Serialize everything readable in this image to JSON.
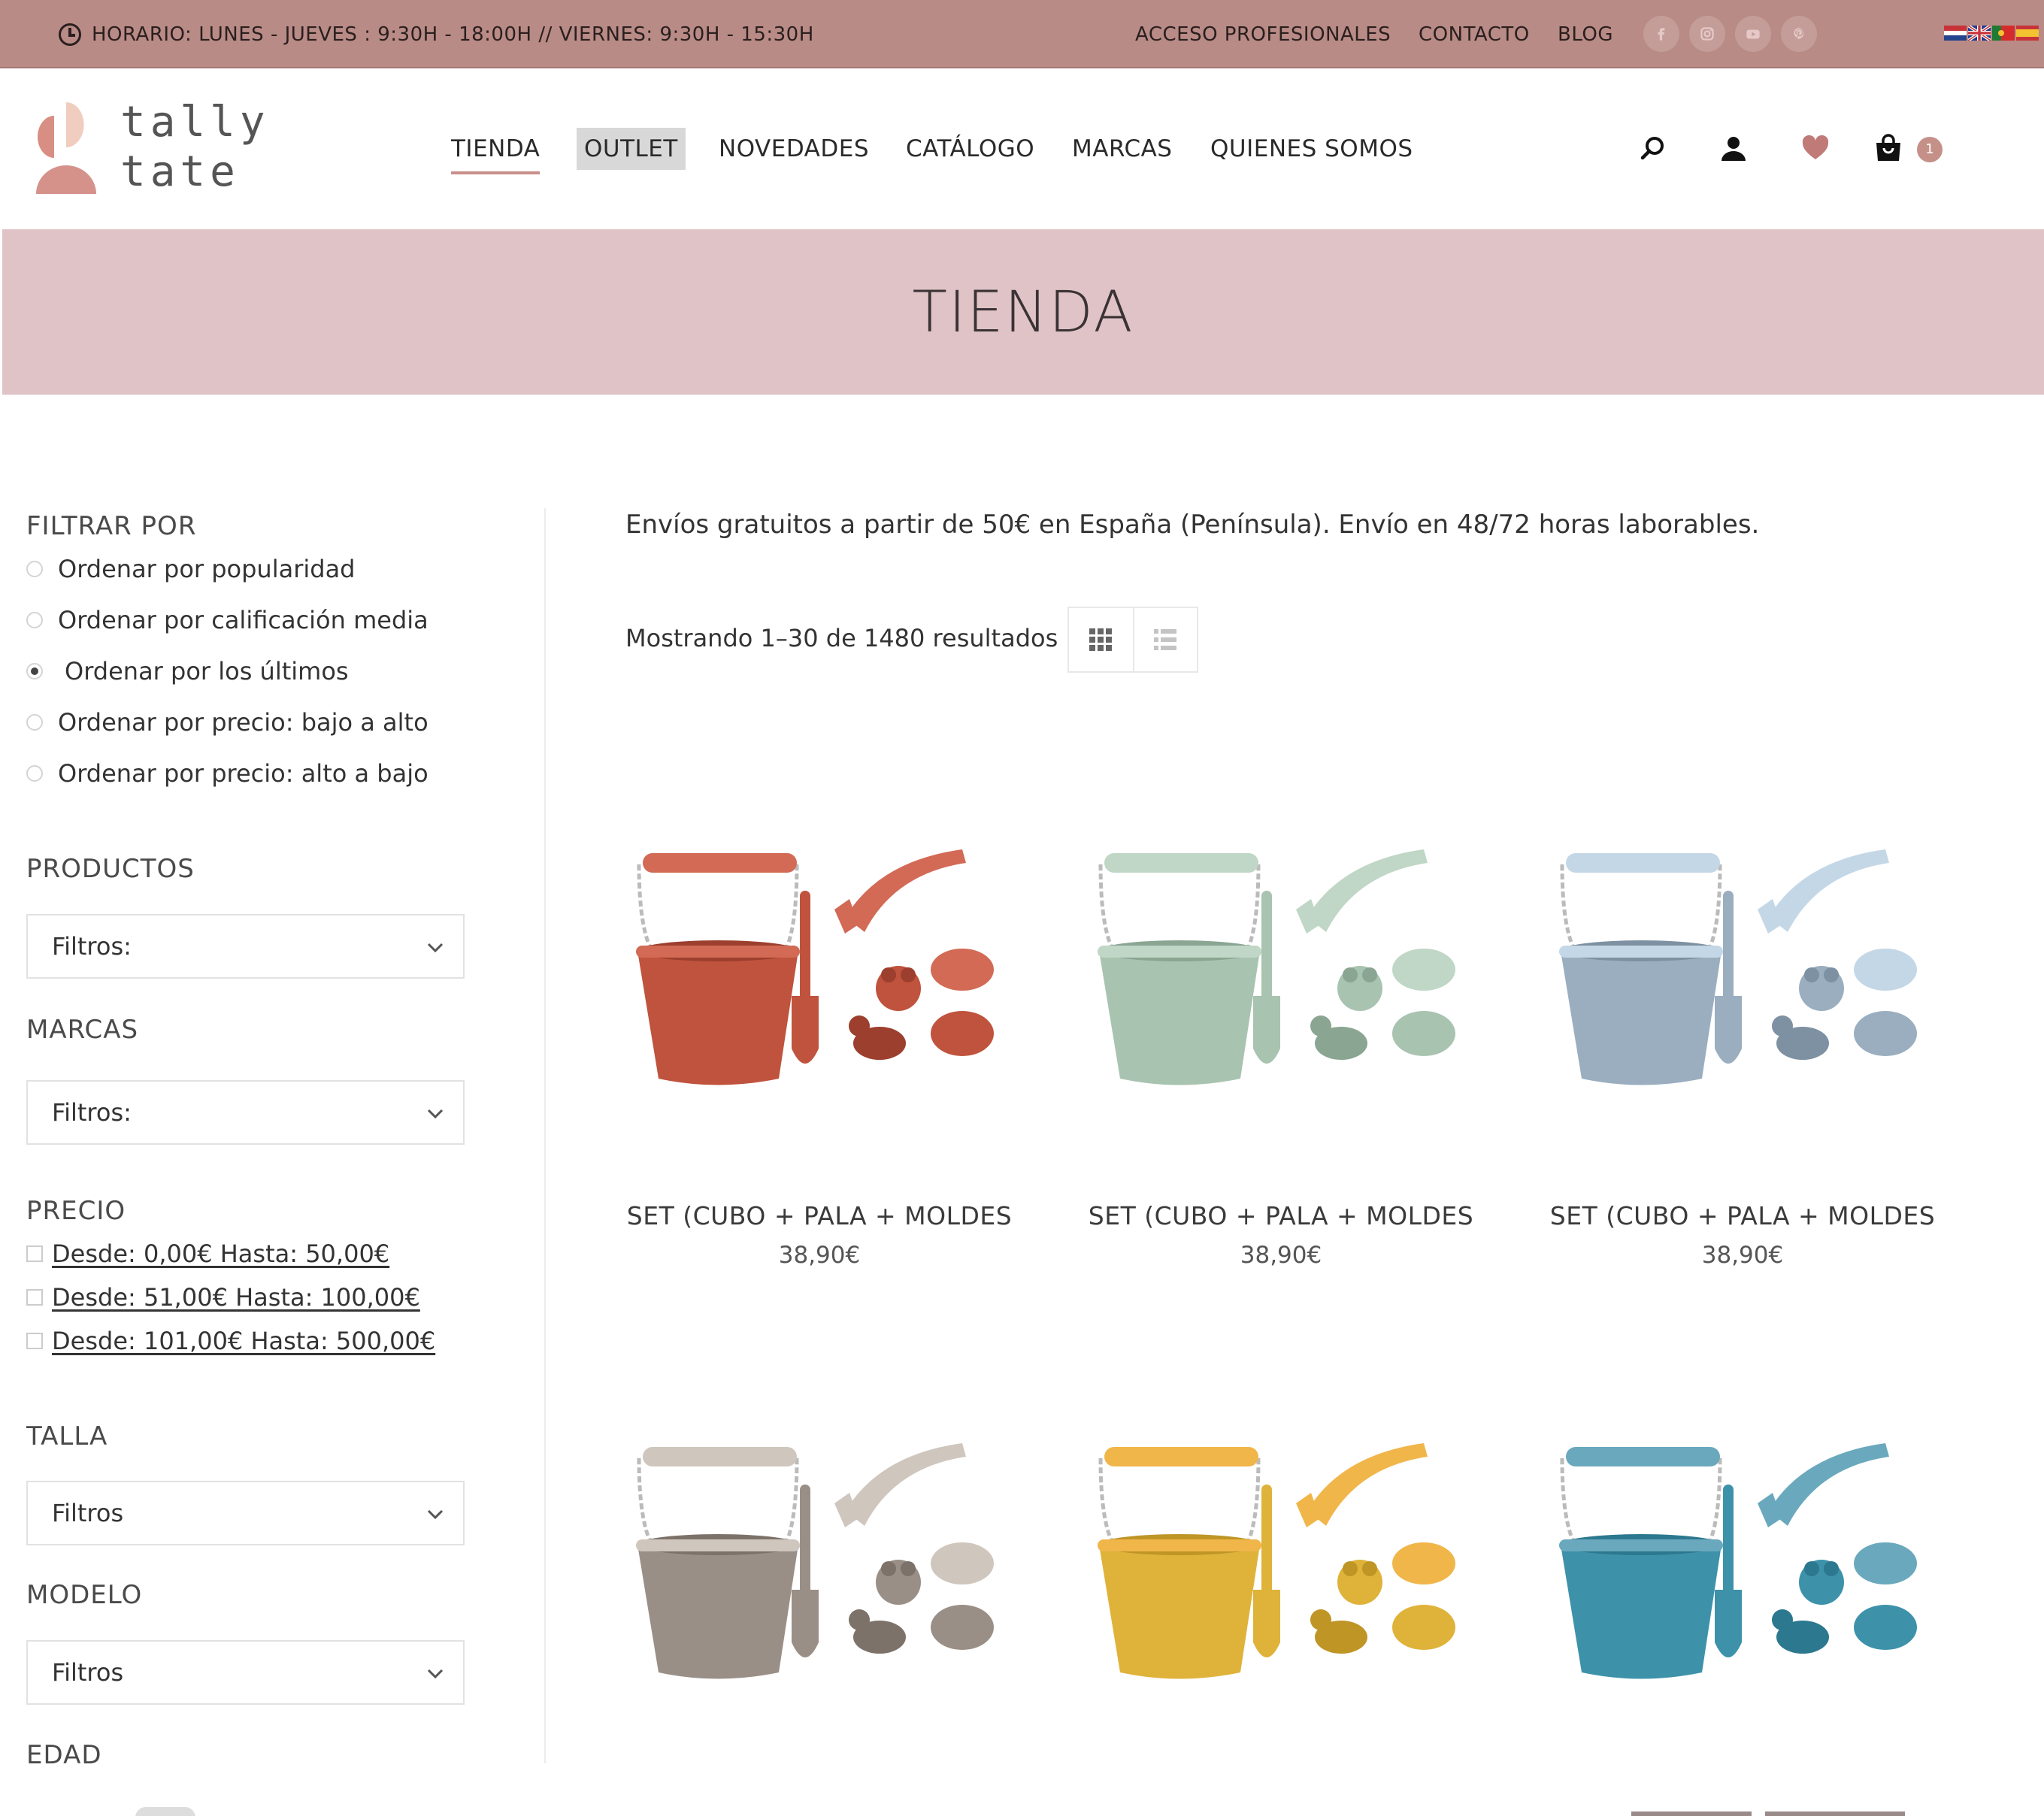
{
  "topbar": {
    "hours": "HORARIO: LUNES - JUEVES : 9:30H - 18:00H // VIERNES: 9:30H - 15:30H",
    "links": [
      "ACCESO PROFESIONALES",
      "CONTACTO",
      "BLOG"
    ],
    "social": [
      "facebook-icon",
      "instagram-icon",
      "youtube-icon",
      "pinterest-icon"
    ],
    "languages": [
      "nl",
      "en",
      "pt",
      "es"
    ],
    "bar_color": "#b98b86"
  },
  "header": {
    "logo_line1": "tally",
    "logo_line2": "tate",
    "nav": [
      "TIENDA",
      "OUTLET",
      "NOVEDADES",
      "CATÁLOGO",
      "MARCAS",
      "QUIENES SOMOS"
    ],
    "active_nav": "TIENDA",
    "cart_count": "1",
    "accent": "#c98f8a"
  },
  "hero": {
    "title": "TIENDA",
    "bg": "#e0c3c6"
  },
  "sidebar": {
    "filter_title": "FILTRAR POR",
    "sort_options": [
      "Ordenar por popularidad",
      "Ordenar por calificación media",
      "Ordenar por los últimos",
      "Ordenar por precio: bajo a alto",
      "Ordenar por precio: alto a bajo"
    ],
    "sort_selected": "Ordenar por los últimos",
    "products_title": "PRODUCTOS",
    "products_select": "Filtros:",
    "brands_title": "MARCAS",
    "brands_select": "Filtros:",
    "price_title": "PRECIO",
    "price_ranges": [
      " Desde: 0,00€ Hasta: 50,00€",
      " Desde: 51,00€ Hasta: 100,00€",
      " Desde: 101,00€ Hasta: 500,00€"
    ],
    "size_title": "TALLA",
    "size_select": "Filtros",
    "model_title": "MODELO",
    "model_select": "Filtros",
    "age_title": "EDAD"
  },
  "main": {
    "shipping": "Envíos gratuitos a partir de 50€ en España (Península). Envío en 48/72 horas laborables.",
    "results": "Mostrando 1–30 de 1480 resultados",
    "view_mode": "grid"
  },
  "products": [
    {
      "name": "SET (CUBO + PALA + MOLDES",
      "price": "38,90€",
      "color": "rust",
      "main": "#c0533d",
      "light": "#d26a55",
      "dark": "#9c3f2e"
    },
    {
      "name": "SET (CUBO + PALA + MOLDES",
      "price": "38,90€",
      "color": "sage",
      "main": "#a9c3b1",
      "light": "#c0d6c6",
      "dark": "#8aa592"
    },
    {
      "name": "SET (CUBO + PALA + MOLDES",
      "price": "38,90€",
      "color": "blue-grey",
      "main": "#9aaebf",
      "light": "#c4d7e6",
      "dark": "#7d91a2"
    },
    {
      "name": "",
      "price": "",
      "color": "taupe",
      "main": "#9a8f86",
      "light": "#cfc6bd",
      "dark": "#7d726a"
    },
    {
      "name": "",
      "price": "",
      "color": "mustard",
      "main": "#dfb23a",
      "light": "#f0b64a",
      "dark": "#bf9526"
    },
    {
      "name": "",
      "price": "",
      "color": "teal",
      "main": "#3d92aa",
      "light": "#6aa8bd",
      "dark": "#2b788f"
    }
  ]
}
